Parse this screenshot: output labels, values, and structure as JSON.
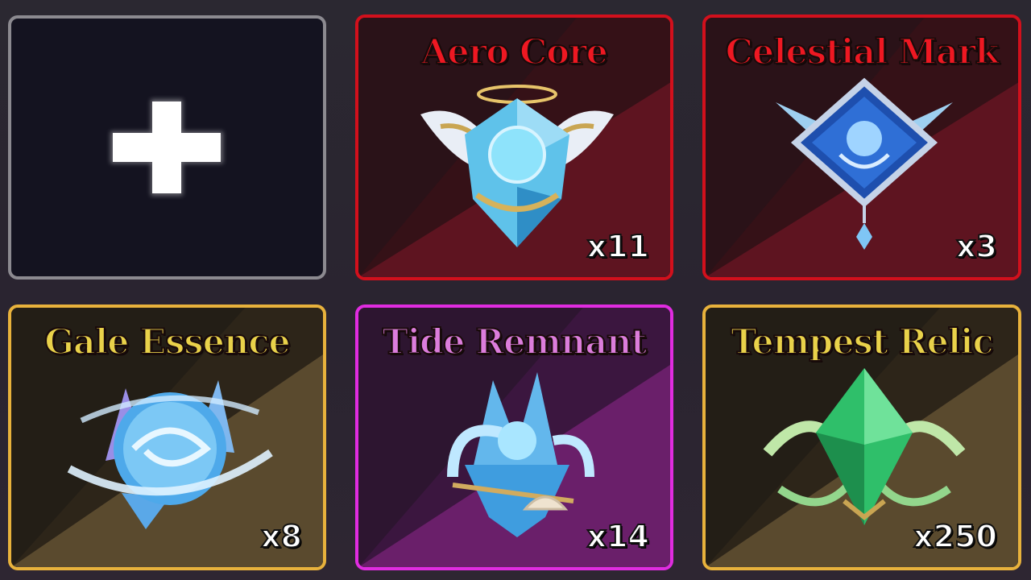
{
  "inventory": {
    "empty_slot": {
      "icon": "plus-icon"
    },
    "items": [
      {
        "name": "Aero Core",
        "quantity": "x11",
        "rarity_color": "#d2101c",
        "name_color": "#ee1822",
        "icon": "winged-crystal-emblem-icon"
      },
      {
        "name": "Celestial Mark",
        "quantity": "x3",
        "rarity_color": "#d2101c",
        "name_color": "#ee1822",
        "icon": "diamond-sigil-icon"
      },
      {
        "name": "Gale Essence",
        "quantity": "x8",
        "rarity_color": "#e8b23c",
        "name_color": "#e9d24a",
        "icon": "swirling-crystal-orb-icon"
      },
      {
        "name": "Tide Remnant",
        "quantity": "x14",
        "rarity_color": "#e02ce0",
        "name_color": "#dc7ddc",
        "icon": "wave-crystal-shell-icon"
      },
      {
        "name": "Tempest Relic",
        "quantity": "x250",
        "rarity_color": "#e8b23c",
        "name_color": "#e9d24a",
        "icon": "green-wind-crystal-icon"
      }
    ]
  }
}
